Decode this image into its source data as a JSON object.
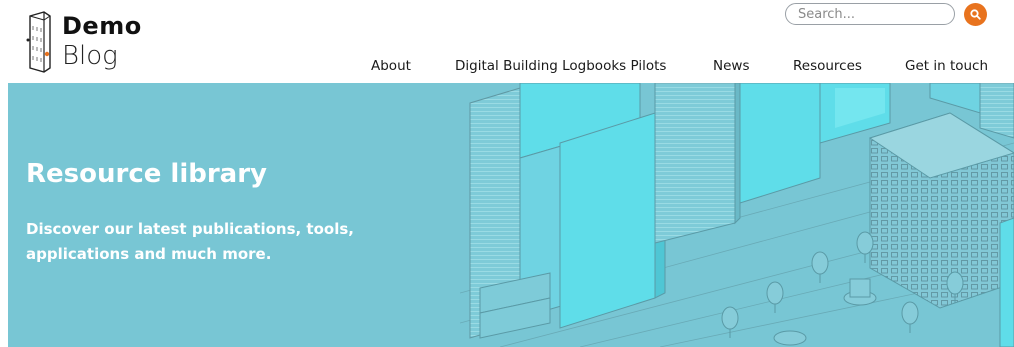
{
  "brand": {
    "line1": "Demo",
    "line2": "Blog"
  },
  "search": {
    "placeholder": "Search...",
    "icon": "search-icon"
  },
  "nav": [
    {
      "label": "About"
    },
    {
      "label": "Digital Building Logbooks Pilots"
    },
    {
      "label": "News"
    },
    {
      "label": "Resources"
    },
    {
      "label": "Get in touch"
    }
  ],
  "hero": {
    "title": "Resource library",
    "subtitle_line1": "Discover our latest publications, tools,",
    "subtitle_line2": "applications and much more."
  },
  "colors": {
    "accent": "#e8731e",
    "hero_bg": "#78c6d4",
    "building_highlight": "#5fdde9"
  }
}
